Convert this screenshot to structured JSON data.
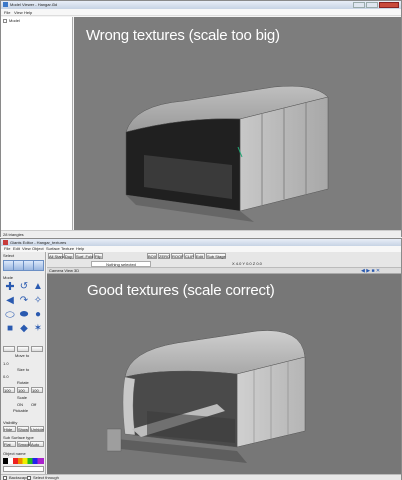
{
  "top_window": {
    "title": "Model Viewer - Hangar.i3d",
    "menu": [
      "File",
      "View",
      "Help"
    ],
    "tree_root": "Model",
    "viewport_caption": "Wrong textures (scale too big)",
    "status_left": "28 triangles"
  },
  "bottom_window": {
    "title": "Giants Editor - Hangar_textures",
    "menu": [
      "File",
      "Edit",
      "View",
      "Object",
      "Surface",
      "Texture",
      "Help"
    ],
    "toolbar_tabs": [
      "All Stand",
      "Dup",
      "Surf. Fold",
      "Flip",
      "BOX",
      "ZERO",
      "ROOF",
      "CLIP",
      "Edit",
      "Sub Stage"
    ],
    "status_field": "Nothing selected",
    "coords": "X 4.0 Y 0.0 Z 0.0",
    "select_label": "Select",
    "mode_label": "Mode",
    "viewport_header": "Camera View 3D",
    "viewport_caption": "Good textures (scale correct)",
    "panel": {
      "move_label": "Move to",
      "move_value": "0.0",
      "size_label": "Size to",
      "size_value": "1.0",
      "rotate_label": "Rotate",
      "rotate_value": "0.0",
      "scale_fields": [
        "100",
        "100",
        "100"
      ],
      "scale_label": "Scale",
      "option_on": "ON",
      "option_off": "Off",
      "pickable_label": "Pickable",
      "visibility_title": "Visibility",
      "vis_buttons": [
        "Hide",
        "Show",
        "Unhide"
      ],
      "sub_surface_title": "Sub Surface type",
      "sub_buttons": [
        "Flat",
        "Smooth",
        "Auto"
      ],
      "object_name_title": "Object name"
    },
    "checkboxes": [
      "Backscape",
      "Select through"
    ]
  }
}
